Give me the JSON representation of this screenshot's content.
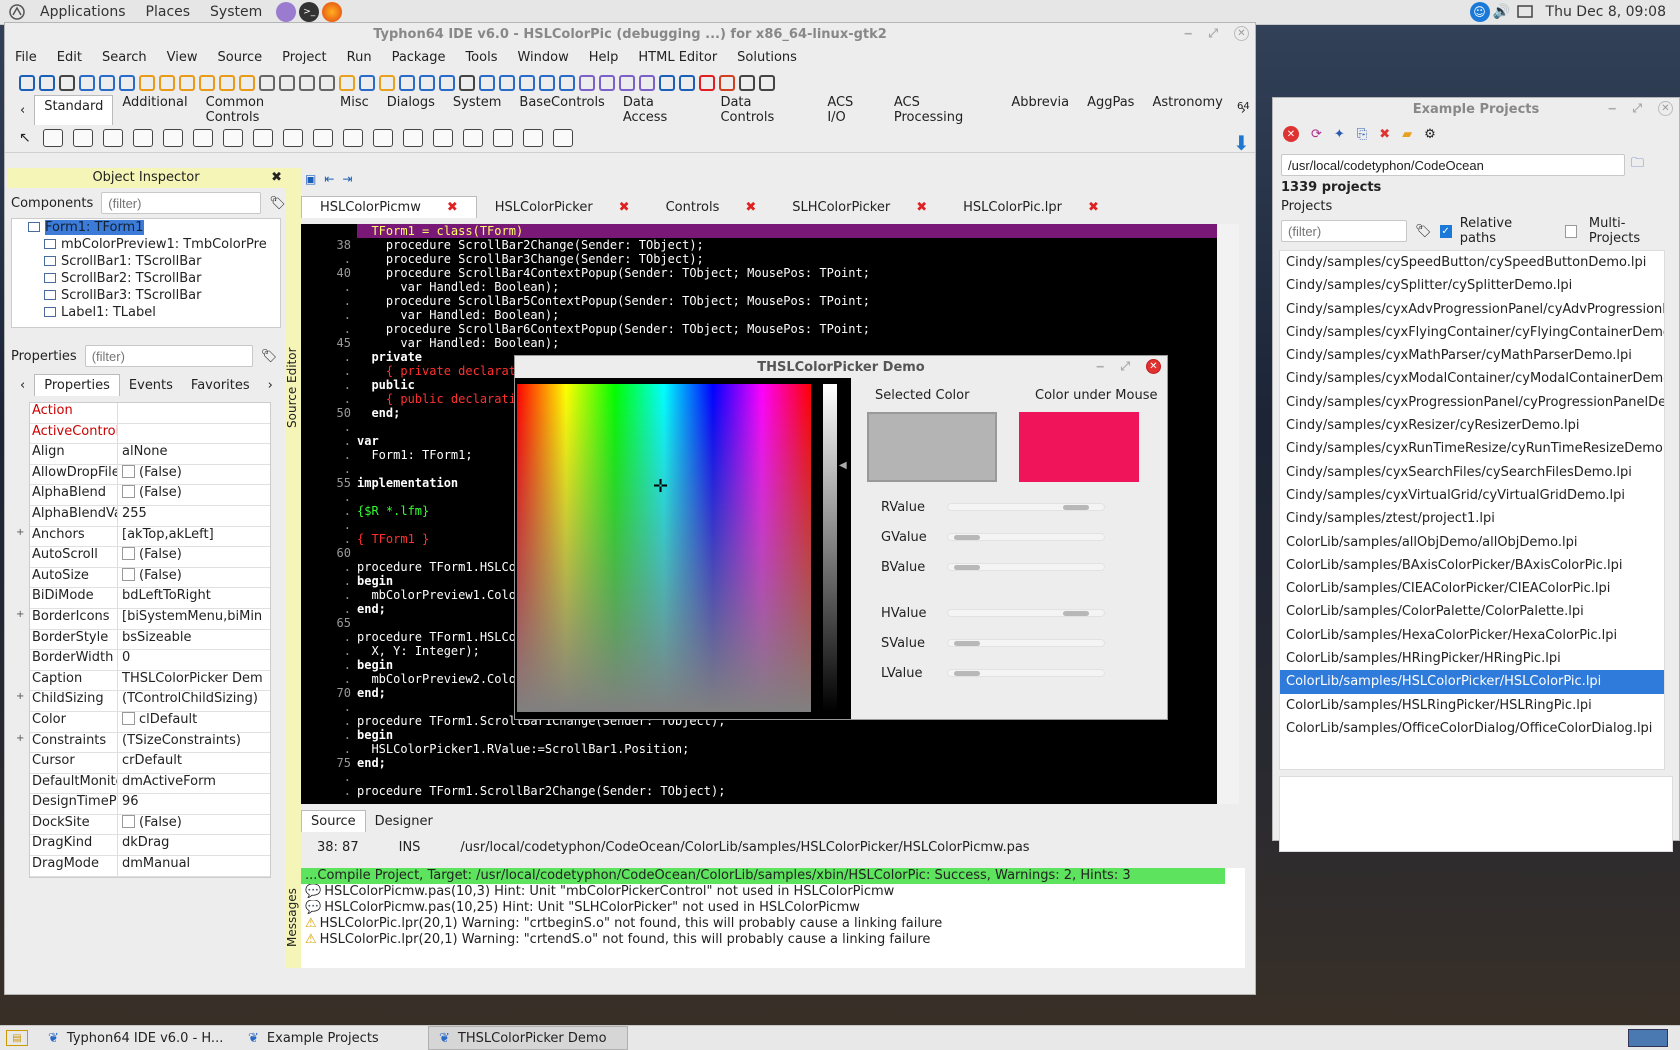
{
  "top_panel": {
    "apps": "Applications",
    "places": "Places",
    "system": "System",
    "clock": "Thu Dec  8, 09:08"
  },
  "ide": {
    "title": "Typhon64 IDE v6.0 - HSLColorPic (debugging ...) for x86_64-linux-gtk2",
    "menu": [
      "File",
      "Edit",
      "Search",
      "View",
      "Source",
      "Project",
      "Run",
      "Package",
      "Tools",
      "Window",
      "Help",
      "HTML Editor",
      "Solutions"
    ],
    "palette_tabs": [
      "Standard",
      "Additional",
      "Common Controls",
      "Misc",
      "Dialogs",
      "System",
      "BaseControls",
      "Data Access",
      "Data Controls",
      "ACS I/O",
      "ACS Processing",
      "Abbrevia",
      "AggPas",
      "Astronomy"
    ],
    "palette_num": "64"
  },
  "oi": {
    "title": "Object Inspector",
    "components_label": "Components",
    "filter": "(filter)",
    "tree": [
      "Form1: TForm1",
      "mbColorPreview1: TmbColorPre",
      "ScrollBar1: TScrollBar",
      "ScrollBar2: TScrollBar",
      "ScrollBar3: TScrollBar",
      "Label1: TLabel"
    ],
    "properties_label": "Properties",
    "tabs": [
      "Properties",
      "Events",
      "Favorites"
    ],
    "props": [
      {
        "n": "Action",
        "v": "",
        "red": true
      },
      {
        "n": "ActiveControl",
        "v": "",
        "red": true
      },
      {
        "n": "Align",
        "v": "alNone"
      },
      {
        "n": "AllowDropFile",
        "v": "(False)",
        "chk": true
      },
      {
        "n": "AlphaBlend",
        "v": "(False)",
        "chk": true
      },
      {
        "n": "AlphaBlendVa",
        "v": "255"
      },
      {
        "n": "Anchors",
        "v": "[akTop,akLeft]",
        "exp": true
      },
      {
        "n": "AutoScroll",
        "v": "(False)",
        "chk": true
      },
      {
        "n": "AutoSize",
        "v": "(False)",
        "chk": true
      },
      {
        "n": "BiDiMode",
        "v": "bdLeftToRight"
      },
      {
        "n": "BorderIcons",
        "v": "[biSystemMenu,biMin",
        "exp": true
      },
      {
        "n": "BorderStyle",
        "v": "bsSizeable"
      },
      {
        "n": "BorderWidth",
        "v": "0"
      },
      {
        "n": "Caption",
        "v": "THSLColorPicker Dem"
      },
      {
        "n": "ChildSizing",
        "v": "(TControlChildSizing)",
        "exp": true
      },
      {
        "n": "Color",
        "v": "clDefault",
        "chk": true
      },
      {
        "n": "Constraints",
        "v": "(TSizeConstraints)",
        "exp": true
      },
      {
        "n": "Cursor",
        "v": "crDefault"
      },
      {
        "n": "DefaultMonito",
        "v": "dmActiveForm"
      },
      {
        "n": "DesignTimePI",
        "v": "96"
      },
      {
        "n": "DockSite",
        "v": "(False)",
        "chk": true
      },
      {
        "n": "DragKind",
        "v": "dkDrag"
      },
      {
        "n": "DragMode",
        "v": "dmManual"
      }
    ]
  },
  "editor": {
    "side_label": "Source Editor",
    "tabs": [
      "HSLColorPicmw",
      "HSLColorPicker",
      "Controls",
      "SLHColorPicker",
      "HSLColorPic.lpr"
    ],
    "gutter": [
      "",
      "38",
      ".",
      "40",
      ".",
      ".",
      ".",
      ".",
      "45",
      ".",
      ".",
      ".",
      ".",
      "50",
      ".",
      ".",
      ".",
      ".",
      "55",
      ".",
      ".",
      ".",
      ".",
      "60",
      ".",
      ".",
      ".",
      ".",
      "65",
      ".",
      ".",
      ".",
      ".",
      "70",
      ".",
      ".",
      ".",
      ".",
      "75",
      ".",
      "."
    ],
    "lines": [
      "  TForm1 = class(TForm)",
      "    procedure ScrollBar2Change(Sender: TObject);",
      "    procedure ScrollBar3Change(Sender: TObject);",
      "    procedure ScrollBar4ContextPopup(Sender: TObject; MousePos: TPoint;",
      "      var Handled: Boolean);",
      "    procedure ScrollBar5ContextPopup(Sender: TObject; MousePos: TPoint;",
      "      var Handled: Boolean);",
      "    procedure ScrollBar6ContextPopup(Sender: TObject; MousePos: TPoint;",
      "      var Handled: Boolean);",
      "  private",
      "    { private declarations }",
      "  public",
      "    { public declarations }",
      "  end;",
      "",
      "var",
      "  Form1: TForm1;",
      "",
      "implementation",
      "",
      "{$R *.lfm}",
      "",
      "{ TForm1 }",
      "",
      "procedure TForm1.HSLColorPicker1Change(Sender: TObject);",
      "begin",
      "  mbColorPreview1.Color := HSLColorPicker1.SelectedColor;",
      "end;",
      "",
      "procedure TForm1.HSLColorPicker1MouseMove(Sender: TObject; Shift: TShiftState;",
      "  X, Y: Integer);",
      "begin",
      "  mbColorPreview2.Color := HSLColorPicker1.ColorUnderCursor;",
      "end;",
      "",
      "procedure TForm1.ScrollBar1Change(Sender: TObject);",
      "begin",
      "  HSLColorPicker1.RValue:=ScrollBar1.Position;",
      "end;",
      "",
      "procedure TForm1.ScrollBar2Change(Sender: TObject);"
    ],
    "bottom_tabs": [
      "Source",
      "Designer"
    ],
    "status": {
      "pos": "38: 87",
      "mode": "INS",
      "file": "/usr/local/codetyphon/CodeOcean/ColorLib/samples/HSLColorPicker/HSLColorPicmw.pas"
    }
  },
  "messages": {
    "side_label": "Messages",
    "success": "...Compile Project, Target: /usr/local/codetyphon/CodeOcean/ColorLib/samples/xbin/HSLColorPic: Success, Warnings: 2, Hints: 3",
    "items": [
      {
        "t": "HSLColorPicmw.pas(10,3) Hint: Unit \"mbColorPickerControl\" not used in HSLColorPicmw",
        "k": "hint"
      },
      {
        "t": "HSLColorPicmw.pas(10,25) Hint: Unit \"SLHColorPicker\" not used in HSLColorPicmw",
        "k": "hint"
      },
      {
        "t": "HSLColorPic.lpr(20,1) Warning: \"crtbeginS.o\" not found, this will probably cause a linking failure",
        "k": "warn"
      },
      {
        "t": "HSLColorPic.lpr(20,1) Warning: \"crtendS.o\" not found, this will probably cause a linking failure",
        "k": "warn"
      }
    ]
  },
  "demo": {
    "title": "THSLColorPicker Demo",
    "selected_label": "Selected Color",
    "under_label": "Color under Mouse",
    "selected_color": "#b4b4b4",
    "under_color": "#f0145a",
    "sliders": [
      {
        "label": "RValue",
        "value": 0.9
      },
      {
        "label": "GValue",
        "value": 0.05
      },
      {
        "label": "BValue",
        "value": 0.05
      },
      {
        "label": "HValue",
        "value": 0.9
      },
      {
        "label": "SValue",
        "value": 0.05
      },
      {
        "label": "LValue",
        "value": 0.05
      }
    ]
  },
  "ep": {
    "title": "Example Projects",
    "path": "/usr/local/codetyphon/CodeOcean",
    "count": "1339 projects",
    "projects_label": "Projects",
    "filter": "(filter)",
    "relative": "Relative paths",
    "multi": "Multi-Projects",
    "items": [
      "Cindy/samples/cySpeedButton/cySpeedButtonDemo.lpi",
      "Cindy/samples/cySplitter/cySplitterDemo.lpi",
      "Cindy/samples/cyxAdvProgressionPanel/cyAdvProgressionPanelDemo.lpi",
      "Cindy/samples/cyxFlyingContainer/cyFlyingContainerDemo.lpi",
      "Cindy/samples/cyxMathParser/cyMathParserDemo.lpi",
      "Cindy/samples/cyxModalContainer/cyModalContainerDemo.lpi",
      "Cindy/samples/cyxProgressionPanel/cyProgressionPanelDemo.lpi",
      "Cindy/samples/cyxResizer/cyResizerDemo.lpi",
      "Cindy/samples/cyxRunTimeResize/cyRunTimeResizeDemo.lpi",
      "Cindy/samples/cyxSearchFiles/cySearchFilesDemo.lpi",
      "Cindy/samples/cyxVirtualGrid/cyVirtualGridDemo.lpi",
      "Cindy/samples/ztest/project1.lpi",
      "ColorLib/samples/allObjDemo/allObjDemo.lpi",
      "ColorLib/samples/BAxisColorPicker/BAxisColorPic.lpi",
      "ColorLib/samples/CIEAColorPicker/CIEAColorPic.lpi",
      "ColorLib/samples/ColorPalette/ColorPalette.lpi",
      "ColorLib/samples/HexaColorPicker/HexaColorPic.lpi",
      "ColorLib/samples/HRingPicker/HRingPic.lpi",
      "ColorLib/samples/HSLColorPicker/HSLColorPic.lpi",
      "ColorLib/samples/HSLRingPicker/HSLRingPic.lpi",
      "ColorLib/samples/OfficeColorDialog/OfficeColorDialog.lpi"
    ],
    "selected_index": 18
  },
  "taskbar": [
    "Typhon64 IDE v6.0 - H...",
    "Example Projects",
    "THSLColorPicker Demo"
  ]
}
